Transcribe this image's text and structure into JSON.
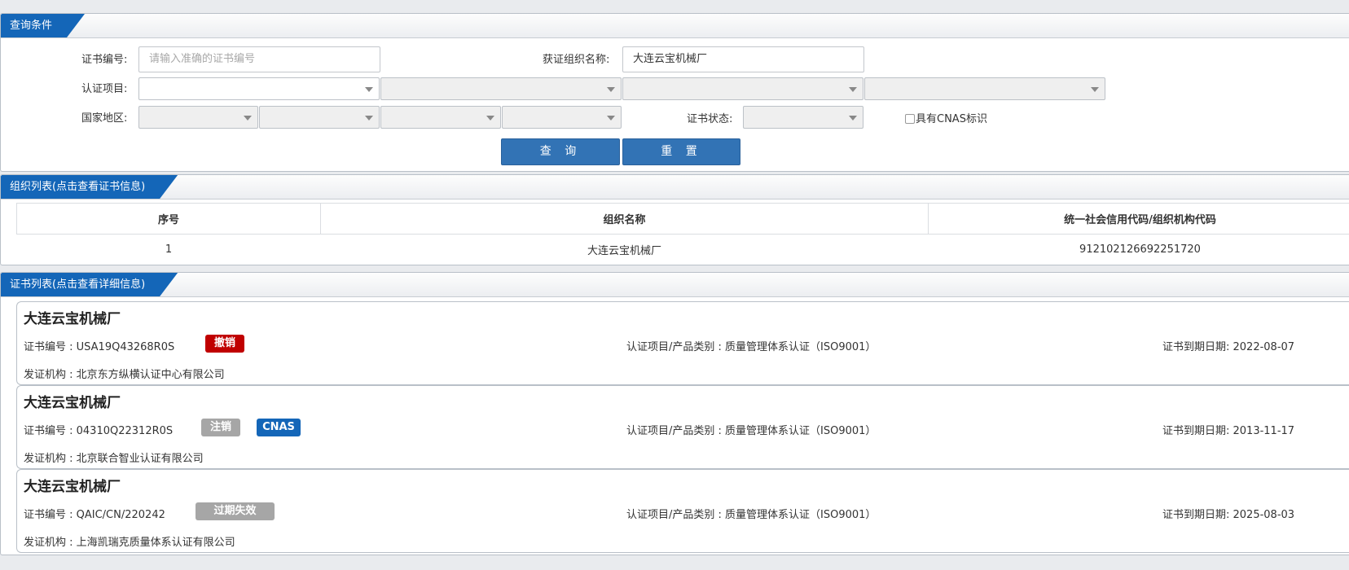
{
  "query": {
    "title": "查询条件",
    "cert_no_label": "证书编号:",
    "cert_no_placeholder": "请输入准确的证书编号",
    "org_name_label": "获证组织名称:",
    "org_name_value": "大连云宝机械厂",
    "cert_project_label": "认证项目:",
    "region_label": "国家地区:",
    "cert_status_label": "证书状态:",
    "cnas_label": "具有CNAS标识",
    "search_button": "查 询",
    "reset_button": "重 置"
  },
  "org_list": {
    "title": "组织列表(点击查看证书信息)",
    "columns": [
      "序号",
      "组织名称",
      "统一社会信用代码/组织机构代码"
    ],
    "rows": [
      [
        "1",
        "大连云宝机械厂",
        "912102126692251720"
      ]
    ]
  },
  "cert_list": {
    "title": "证书列表(点击查看详细信息)",
    "items": [
      {
        "org": "大连云宝机械厂",
        "cert_no": "证书编号 : USA19Q43268R0S",
        "status": "撤销",
        "status_color": "#c00000",
        "cnas": "",
        "project": "认证项目/产品类别 : 质量管理体系认证（ISO9001）",
        "expiry": "证书到期日期: 2022-08-07",
        "issuer": "发证机构 : 北京东方纵横认证中心有限公司"
      },
      {
        "org": "大连云宝机械厂",
        "cert_no": "证书编号 : 04310Q22312R0S",
        "status": "注销",
        "status_color": "#a6a6a6",
        "cnas": "CNAS",
        "cnas_color": "#1466b8",
        "project": "认证项目/产品类别 : 质量管理体系认证（ISO9001）",
        "expiry": "证书到期日期: 2013-11-17",
        "issuer": "发证机构 : 北京联合智业认证有限公司"
      },
      {
        "org": "大连云宝机械厂",
        "cert_no": "证书编号 : QAIC/CN/220242",
        "status": "过期失效",
        "status_color": "#a6a6a6",
        "cnas": "",
        "project": "认证项目/产品类别 : 质量管理体系认证（ISO9001）",
        "expiry": "证书到期日期: 2025-08-03",
        "issuer": "发证机构 : 上海凯瑞克质量体系认证有限公司"
      }
    ]
  }
}
